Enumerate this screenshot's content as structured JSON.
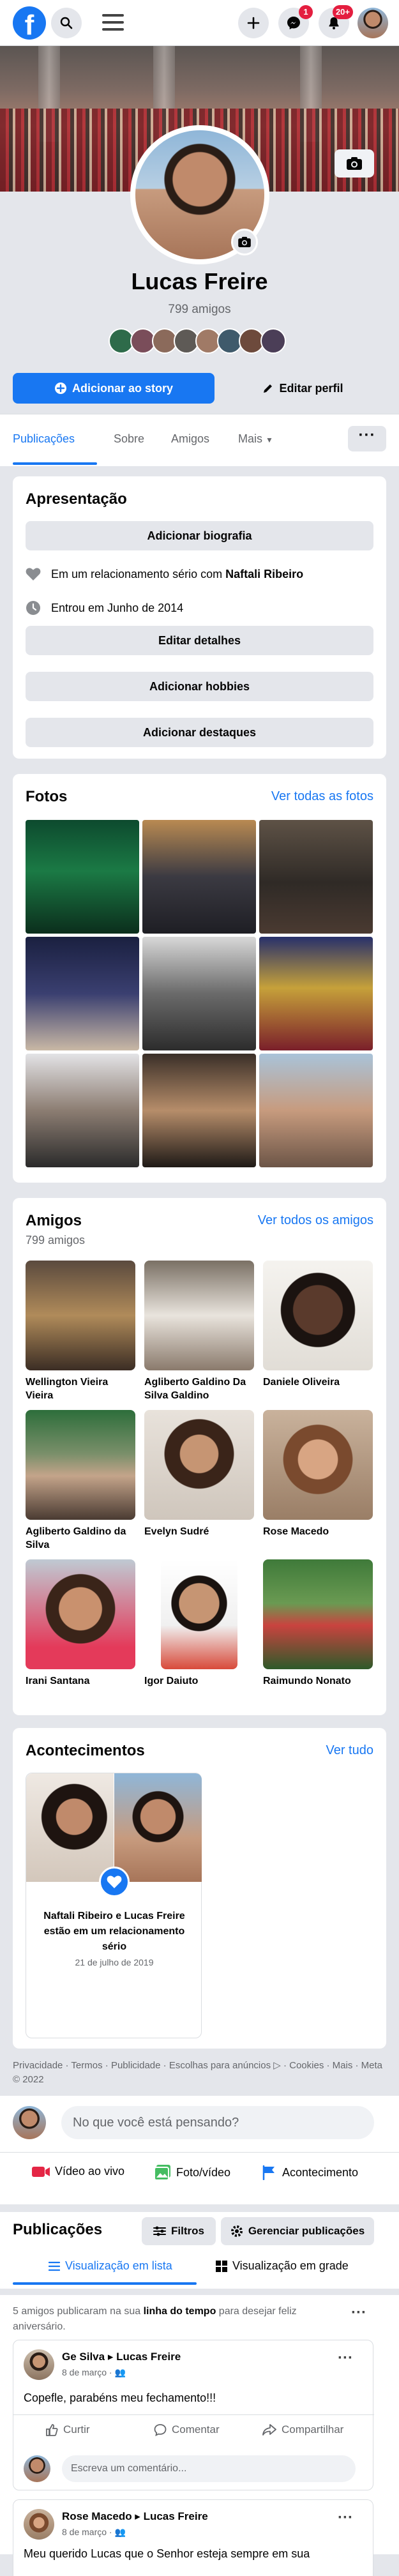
{
  "topbar": {
    "messenger_badge": "1",
    "notifications_badge": "20+"
  },
  "profile": {
    "name": "Lucas Freire",
    "friends_count": "799 amigos"
  },
  "actions": {
    "add_story": "Adicionar ao story",
    "edit_profile": "Editar perfil"
  },
  "tabs": {
    "posts": "Publicações",
    "about": "Sobre",
    "friends": "Amigos",
    "more": "Mais"
  },
  "intro": {
    "title": "Apresentação",
    "add_bio": "Adicionar biografia",
    "relationship_prefix": "Em um relacionamento sério com ",
    "relationship_partner": "Naftali Ribeiro",
    "joined": "Entrou em Junho de 2014",
    "edit_details": "Editar detalhes",
    "add_hobbies": "Adicionar hobbies",
    "add_featured": "Adicionar destaques"
  },
  "photos": {
    "title": "Fotos",
    "see_all": "Ver todas as fotos"
  },
  "friends": {
    "title": "Amigos",
    "count": "799 amigos",
    "see_all": "Ver todos os amigos",
    "list": [
      {
        "name": "Wellington Vieira Vieira"
      },
      {
        "name": "Agliberto Galdino Da Silva Galdino"
      },
      {
        "name": "Daniele Oliveira"
      },
      {
        "name": "Agliberto Galdino da Silva"
      },
      {
        "name": "Evelyn Sudré"
      },
      {
        "name": "Rose Macedo"
      },
      {
        "name": "Irani Santana"
      },
      {
        "name": "Igor Daiuto"
      },
      {
        "name": "Raimundo Nonato"
      }
    ]
  },
  "events": {
    "title": "Acontecimentos",
    "see_all": "Ver tudo",
    "item_text": "Naftali Ribeiro e Lucas Freire estão em um relacionamento sério",
    "item_date": "21 de julho de 2019"
  },
  "footer": {
    "text": "Privacidade · Termos · Publicidade · Escolhas para anúncios ▷ · Cookies · Mais · Meta © 2022"
  },
  "composer": {
    "placeholder": "No que você está pensando?",
    "live": "Vídeo ao vivo",
    "photo": "Foto/vídeo",
    "event": "Acontecimento"
  },
  "posts": {
    "title": "Publicações",
    "filters": "Filtros",
    "manage": "Gerenciar publicações",
    "list_view": "Visualização em lista",
    "grid_view": "Visualização em grade",
    "birthday_prefix": "5 amigos publicaram na sua ",
    "birthday_link": "linha do tempo",
    "birthday_suffix": " para desejar feliz aniversário.",
    "items": [
      {
        "author": "Ge Silva ▸ Lucas Freire",
        "date": "8 de março · ",
        "text": "Copefle, parabéns meu fechamento!!!"
      },
      {
        "author": "Rose Macedo ▸ Lucas Freire",
        "date": "8 de março · ",
        "text": "Meu querido Lucas que o Senhor esteja sempre em sua"
      }
    ],
    "like": "Curtir",
    "comment": "Comentar",
    "share": "Compartilhar",
    "comment_placeholder": "Escreva um comentário..."
  },
  "colors": {
    "accent": "#1877f2",
    "badge": "#e41e3f"
  }
}
